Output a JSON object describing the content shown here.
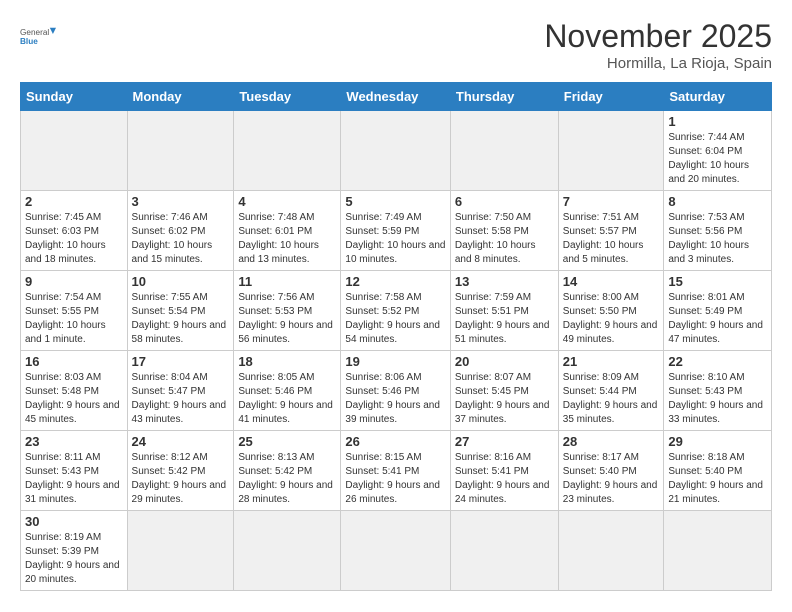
{
  "logo": {
    "line1": "General",
    "line2": "Blue"
  },
  "header": {
    "title": "November 2025",
    "subtitle": "Hormilla, La Rioja, Spain"
  },
  "weekdays": [
    "Sunday",
    "Monday",
    "Tuesday",
    "Wednesday",
    "Thursday",
    "Friday",
    "Saturday"
  ],
  "weeks": [
    [
      {
        "day": "",
        "info": ""
      },
      {
        "day": "",
        "info": ""
      },
      {
        "day": "",
        "info": ""
      },
      {
        "day": "",
        "info": ""
      },
      {
        "day": "",
        "info": ""
      },
      {
        "day": "",
        "info": ""
      },
      {
        "day": "1",
        "info": "Sunrise: 7:44 AM\nSunset: 6:04 PM\nDaylight: 10 hours\nand 20 minutes."
      }
    ],
    [
      {
        "day": "2",
        "info": "Sunrise: 7:45 AM\nSunset: 6:03 PM\nDaylight: 10 hours\nand 18 minutes."
      },
      {
        "day": "3",
        "info": "Sunrise: 7:46 AM\nSunset: 6:02 PM\nDaylight: 10 hours\nand 15 minutes."
      },
      {
        "day": "4",
        "info": "Sunrise: 7:48 AM\nSunset: 6:01 PM\nDaylight: 10 hours\nand 13 minutes."
      },
      {
        "day": "5",
        "info": "Sunrise: 7:49 AM\nSunset: 5:59 PM\nDaylight: 10 hours\nand 10 minutes."
      },
      {
        "day": "6",
        "info": "Sunrise: 7:50 AM\nSunset: 5:58 PM\nDaylight: 10 hours\nand 8 minutes."
      },
      {
        "day": "7",
        "info": "Sunrise: 7:51 AM\nSunset: 5:57 PM\nDaylight: 10 hours\nand 5 minutes."
      },
      {
        "day": "8",
        "info": "Sunrise: 7:53 AM\nSunset: 5:56 PM\nDaylight: 10 hours\nand 3 minutes."
      }
    ],
    [
      {
        "day": "9",
        "info": "Sunrise: 7:54 AM\nSunset: 5:55 PM\nDaylight: 10 hours\nand 1 minute."
      },
      {
        "day": "10",
        "info": "Sunrise: 7:55 AM\nSunset: 5:54 PM\nDaylight: 9 hours\nand 58 minutes."
      },
      {
        "day": "11",
        "info": "Sunrise: 7:56 AM\nSunset: 5:53 PM\nDaylight: 9 hours\nand 56 minutes."
      },
      {
        "day": "12",
        "info": "Sunrise: 7:58 AM\nSunset: 5:52 PM\nDaylight: 9 hours\nand 54 minutes."
      },
      {
        "day": "13",
        "info": "Sunrise: 7:59 AM\nSunset: 5:51 PM\nDaylight: 9 hours\nand 51 minutes."
      },
      {
        "day": "14",
        "info": "Sunrise: 8:00 AM\nSunset: 5:50 PM\nDaylight: 9 hours\nand 49 minutes."
      },
      {
        "day": "15",
        "info": "Sunrise: 8:01 AM\nSunset: 5:49 PM\nDaylight: 9 hours\nand 47 minutes."
      }
    ],
    [
      {
        "day": "16",
        "info": "Sunrise: 8:03 AM\nSunset: 5:48 PM\nDaylight: 9 hours\nand 45 minutes."
      },
      {
        "day": "17",
        "info": "Sunrise: 8:04 AM\nSunset: 5:47 PM\nDaylight: 9 hours\nand 43 minutes."
      },
      {
        "day": "18",
        "info": "Sunrise: 8:05 AM\nSunset: 5:46 PM\nDaylight: 9 hours\nand 41 minutes."
      },
      {
        "day": "19",
        "info": "Sunrise: 8:06 AM\nSunset: 5:46 PM\nDaylight: 9 hours\nand 39 minutes."
      },
      {
        "day": "20",
        "info": "Sunrise: 8:07 AM\nSunset: 5:45 PM\nDaylight: 9 hours\nand 37 minutes."
      },
      {
        "day": "21",
        "info": "Sunrise: 8:09 AM\nSunset: 5:44 PM\nDaylight: 9 hours\nand 35 minutes."
      },
      {
        "day": "22",
        "info": "Sunrise: 8:10 AM\nSunset: 5:43 PM\nDaylight: 9 hours\nand 33 minutes."
      }
    ],
    [
      {
        "day": "23",
        "info": "Sunrise: 8:11 AM\nSunset: 5:43 PM\nDaylight: 9 hours\nand 31 minutes."
      },
      {
        "day": "24",
        "info": "Sunrise: 8:12 AM\nSunset: 5:42 PM\nDaylight: 9 hours\nand 29 minutes."
      },
      {
        "day": "25",
        "info": "Sunrise: 8:13 AM\nSunset: 5:42 PM\nDaylight: 9 hours\nand 28 minutes."
      },
      {
        "day": "26",
        "info": "Sunrise: 8:15 AM\nSunset: 5:41 PM\nDaylight: 9 hours\nand 26 minutes."
      },
      {
        "day": "27",
        "info": "Sunrise: 8:16 AM\nSunset: 5:41 PM\nDaylight: 9 hours\nand 24 minutes."
      },
      {
        "day": "28",
        "info": "Sunrise: 8:17 AM\nSunset: 5:40 PM\nDaylight: 9 hours\nand 23 minutes."
      },
      {
        "day": "29",
        "info": "Sunrise: 8:18 AM\nSunset: 5:40 PM\nDaylight: 9 hours\nand 21 minutes."
      }
    ],
    [
      {
        "day": "30",
        "info": "Sunrise: 8:19 AM\nSunset: 5:39 PM\nDaylight: 9 hours\nand 20 minutes."
      },
      {
        "day": "",
        "info": ""
      },
      {
        "day": "",
        "info": ""
      },
      {
        "day": "",
        "info": ""
      },
      {
        "day": "",
        "info": ""
      },
      {
        "day": "",
        "info": ""
      },
      {
        "day": "",
        "info": ""
      }
    ]
  ],
  "colors": {
    "header_bg": "#2b7ec1",
    "empty_bg": "#f0f0f0",
    "border": "#cccccc"
  }
}
